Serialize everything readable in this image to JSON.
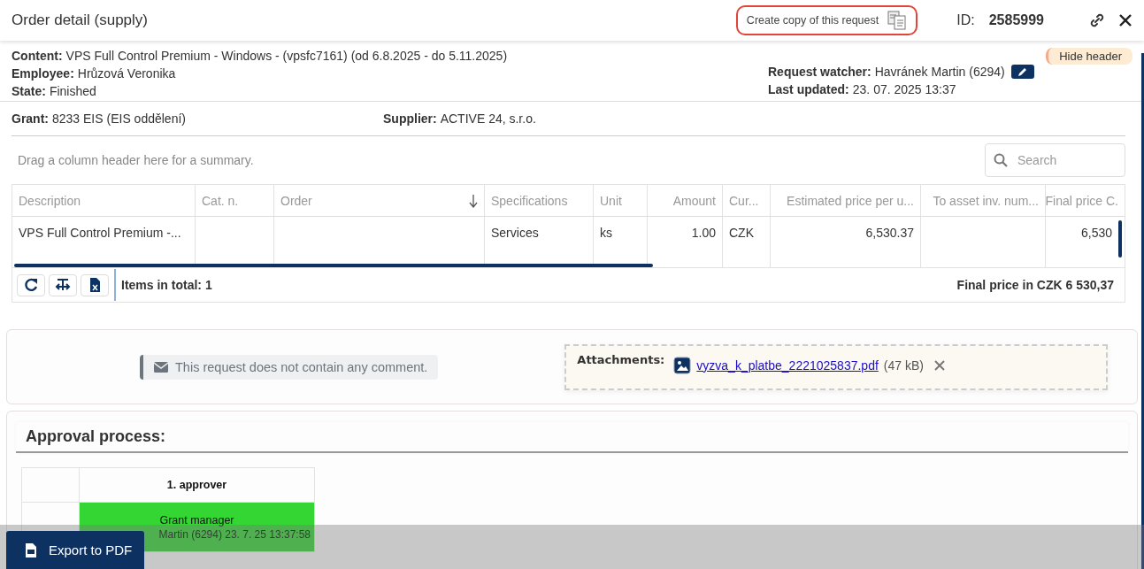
{
  "header": {
    "title": "Order detail (supply)",
    "copy_button": "Create copy of this request",
    "id_label": "ID:",
    "id_value": "2585999"
  },
  "hide_header": "Hide header",
  "info_left": [
    {
      "label": "Content:",
      "value": "VPS Full Control Premium - Windows - (vpsfc7161) (od 6.8.2025 - do 5.11.2025)"
    },
    {
      "label": "Employee:",
      "value": "Hrůzová Veronika"
    },
    {
      "label": "State:",
      "value": "Finished"
    }
  ],
  "info_right": [
    {
      "label": "Request watcher:",
      "value": "Havránek Martin (6294)",
      "editable": true
    },
    {
      "label": "Last updated:",
      "value": "23. 07. 2025 13:37"
    }
  ],
  "summary_row": [
    {
      "label": "Grant:",
      "value": "8233 EIS (EIS oddělení)"
    },
    {
      "label": "Supplier:",
      "value": "ACTIVE 24, s.r.o."
    }
  ],
  "grid": {
    "group_hint": "Drag a column header here for a summary.",
    "search": {
      "placeholder": "Search"
    },
    "columns": [
      {
        "label": "Description",
        "kind": "text",
        "sorted": false
      },
      {
        "label": "Cat. n.",
        "kind": "text",
        "sorted": false
      },
      {
        "label": "Order",
        "kind": "text",
        "sorted": true
      },
      {
        "label": "Specifications",
        "kind": "text",
        "sorted": false
      },
      {
        "label": "Unit",
        "kind": "text",
        "sorted": false
      },
      {
        "label": "Amount",
        "kind": "number",
        "sorted": false
      },
      {
        "label": "Cur...",
        "kind": "text",
        "sorted": false
      },
      {
        "label": "Estimated price per u...",
        "kind": "number",
        "sorted": false
      },
      {
        "label": "To asset inv. num...",
        "kind": "number",
        "sorted": false
      },
      {
        "label": "Final price C.",
        "kind": "number",
        "sorted": false
      }
    ],
    "rows": [
      [
        "VPS Full Control Premium -...",
        "",
        "",
        "Services",
        "ks",
        "1.00",
        "CZK",
        "6,530.37",
        "",
        "6,530"
      ]
    ],
    "footer": {
      "total": "Items in total: 1",
      "price_label": "Final price in CZK",
      "price_value": "6 530,37"
    }
  },
  "comment": "This request does not contain any comment.",
  "attachments": {
    "label": "Attachments:",
    "files": [
      {
        "name": "vyzva_k_platbe_2221025837.pdf",
        "size": "(47 kB)"
      }
    ]
  },
  "approval": {
    "title": "Approval process:",
    "columns": [
      "1. approver"
    ],
    "steps": [
      {
        "role": "Grant manager",
        "person": "Martin (6294) 23. 7. 25 13:37:58",
        "kind": "approved"
      }
    ]
  },
  "export_button": "Export to PDF"
}
